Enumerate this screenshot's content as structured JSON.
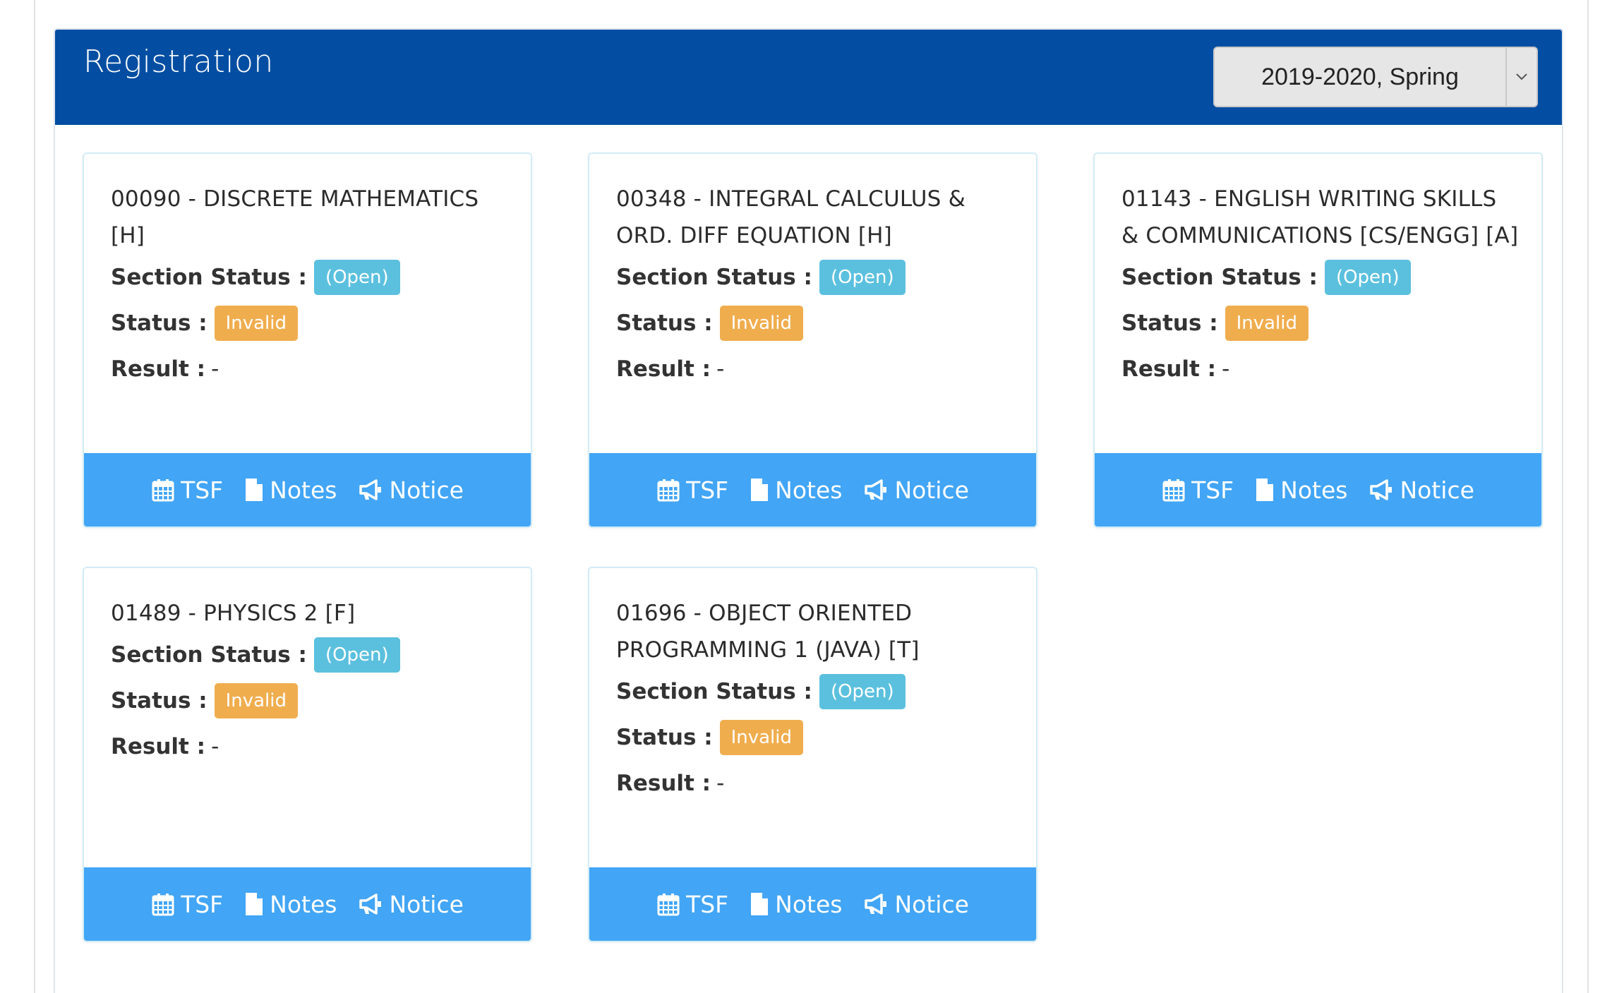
{
  "header": {
    "title": "Registration",
    "semester": "2019-2020, Spring"
  },
  "labels": {
    "section_status": "Section Status :",
    "status": "Status :",
    "result": "Result :"
  },
  "footer": {
    "tsf": "TSF",
    "notes": "Notes",
    "notice": "Notice"
  },
  "courses": [
    {
      "title": "00090 - DISCRETE MATHEMATICS [H]",
      "section_status": "(Open)",
      "status": "Invalid",
      "result": "-"
    },
    {
      "title": "00348 - INTEGRAL CALCULUS & ORD. DIFF EQUATION [H]",
      "section_status": "(Open)",
      "status": "Invalid",
      "result": "-"
    },
    {
      "title": "01143 - ENGLISH WRITING SKILLS & COMMUNICATIONS [CS/ENGG] [A]",
      "section_status": "(Open)",
      "status": "Invalid",
      "result": "-"
    },
    {
      "title": "01489 - PHYSICS 2 [F]",
      "section_status": "(Open)",
      "status": "Invalid",
      "result": "-"
    },
    {
      "title": "01696 - OBJECT ORIENTED PROGRAMMING 1 (JAVA) [T]",
      "section_status": "(Open)",
      "status": "Invalid",
      "result": "-"
    }
  ],
  "colors": {
    "header_bg": "#034ea2",
    "footer_bg": "#42a5f5",
    "badge_open": "#5bc0de",
    "badge_invalid": "#f0ad4e"
  }
}
